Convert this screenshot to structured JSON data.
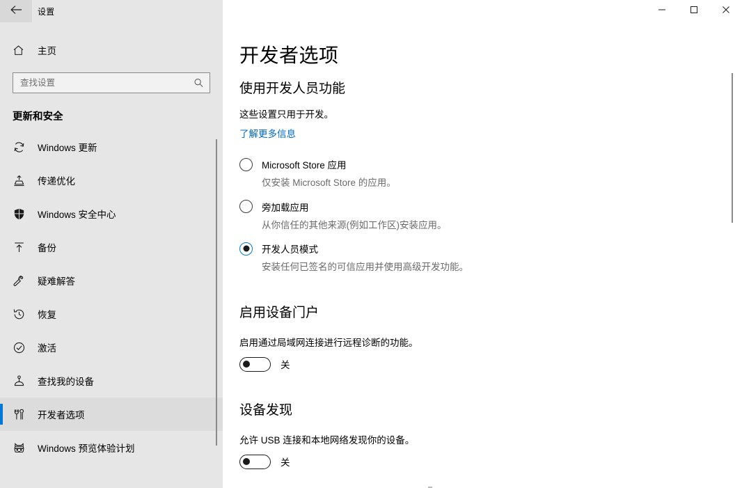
{
  "window": {
    "title": "设置",
    "back_icon": "back-arrow-icon",
    "controls": {
      "minimize": "minimize-icon",
      "maximize": "maximize-icon",
      "close": "close-icon"
    }
  },
  "sidebar": {
    "home": {
      "label": "主页",
      "icon": "home-icon"
    },
    "search": {
      "placeholder": "查找设置",
      "value": "",
      "icon": "search-icon"
    },
    "category": "更新和安全",
    "items": [
      {
        "label": "Windows 更新",
        "icon": "sync-refresh-icon",
        "selected": false
      },
      {
        "label": "传递优化",
        "icon": "delivery-optimization-icon",
        "selected": false
      },
      {
        "label": "Windows 安全中心",
        "icon": "shield-icon",
        "selected": false
      },
      {
        "label": "备份",
        "icon": "upload-arrow-icon",
        "selected": false
      },
      {
        "label": "疑难解答",
        "icon": "wrench-icon",
        "selected": false
      },
      {
        "label": "恢复",
        "icon": "history-clock-icon",
        "selected": false
      },
      {
        "label": "激活",
        "icon": "check-circle-icon",
        "selected": false
      },
      {
        "label": "查找我的设备",
        "icon": "find-device-pin-icon",
        "selected": false
      },
      {
        "label": "开发者选项",
        "icon": "developer-tools-icon",
        "selected": true
      },
      {
        "label": "Windows 预览体验计划",
        "icon": "ninja-cat-icon",
        "selected": false
      }
    ]
  },
  "main": {
    "page_title": "开发者选项",
    "developer_features": {
      "heading": "使用开发人员功能",
      "description": "这些设置只用于开发。",
      "link": "了解更多信息",
      "options": [
        {
          "label": "Microsoft Store 应用",
          "description": "仅安装 Microsoft Store 的应用。",
          "checked": false
        },
        {
          "label": "旁加载应用",
          "description": "从你信任的其他来源(例如工作区)安装应用。",
          "checked": false
        },
        {
          "label": "开发人员模式",
          "description": "安装任何已签名的可信应用并使用高级开发功能。",
          "checked": true
        }
      ]
    },
    "device_portal": {
      "heading": "启用设备门户",
      "description": "启用通过局域网连接进行远程诊断的功能。",
      "toggle_state": "关",
      "toggle_on": false
    },
    "device_discovery": {
      "heading": "设备发现",
      "description": "允许 USB 连接和本地网络发现你的设备。",
      "toggle_state": "关",
      "toggle_on": false
    }
  },
  "colors": {
    "accent": "#0078d7",
    "sidebar_bg": "#e6e6e6",
    "content_bg": "#ffffff",
    "link": "#0067c0",
    "muted_text": "#6b6b6b"
  }
}
